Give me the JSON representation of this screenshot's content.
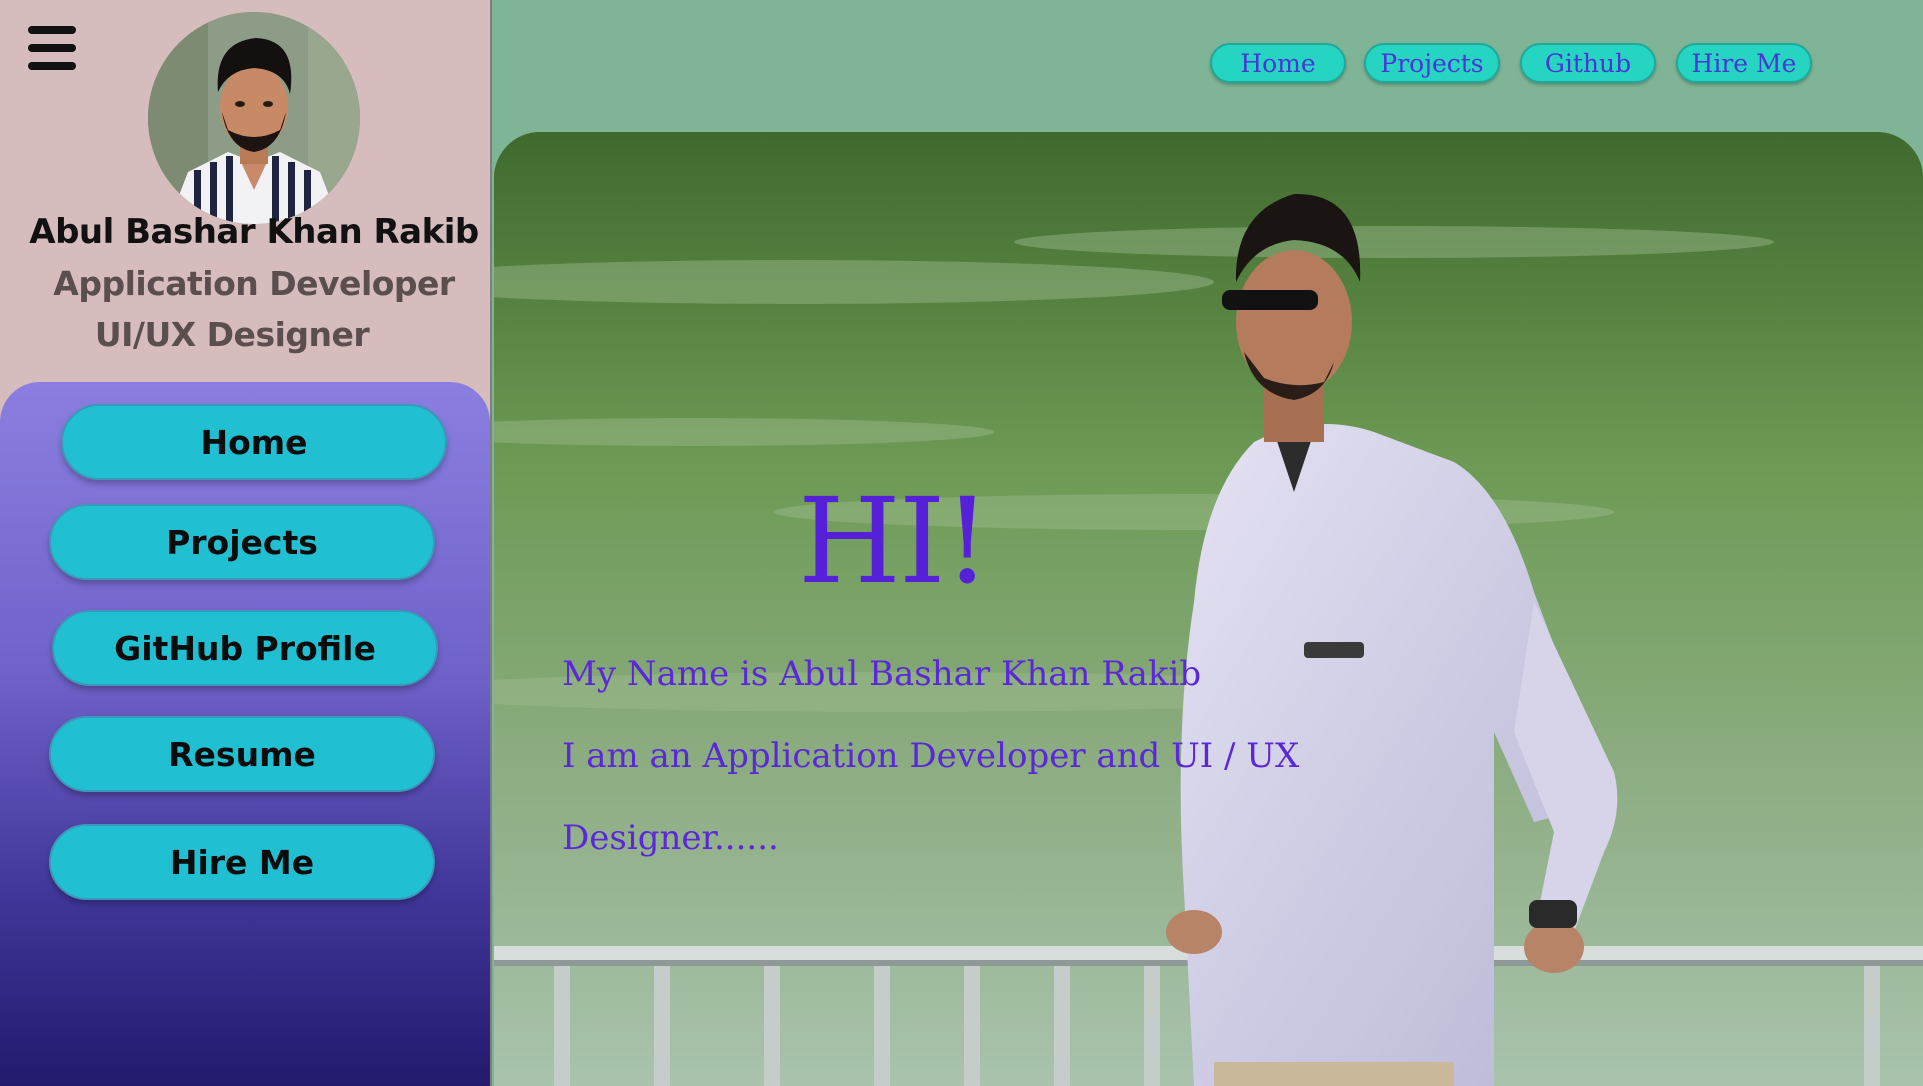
{
  "sidebar": {
    "profile": {
      "name": "Abul Bashar Khan Rakib",
      "roles": [
        "Application Developer",
        "UI/UX Designer"
      ]
    },
    "nav": [
      {
        "label": "Home"
      },
      {
        "label": "Projects"
      },
      {
        "label": "GitHub Profile"
      },
      {
        "label": "Resume"
      },
      {
        "label": "Hire Me"
      }
    ]
  },
  "topnav": [
    {
      "label": "Home"
    },
    {
      "label": "Projects"
    },
    {
      "label": "Github"
    },
    {
      "label": "Hire Me"
    }
  ],
  "hero": {
    "greeting": "HI!",
    "lines": [
      "My Name is Abul Bashar Khan Rakib",
      "I am an Application Developer and UI / UX",
      "Designer......"
    ]
  },
  "colors": {
    "sidebar_bg": "#d6bcbd",
    "nav_button": "#20c0d2",
    "top_button": "#26d4c2",
    "accent_text": "#5520d8",
    "page_bg": "#7fb596"
  }
}
